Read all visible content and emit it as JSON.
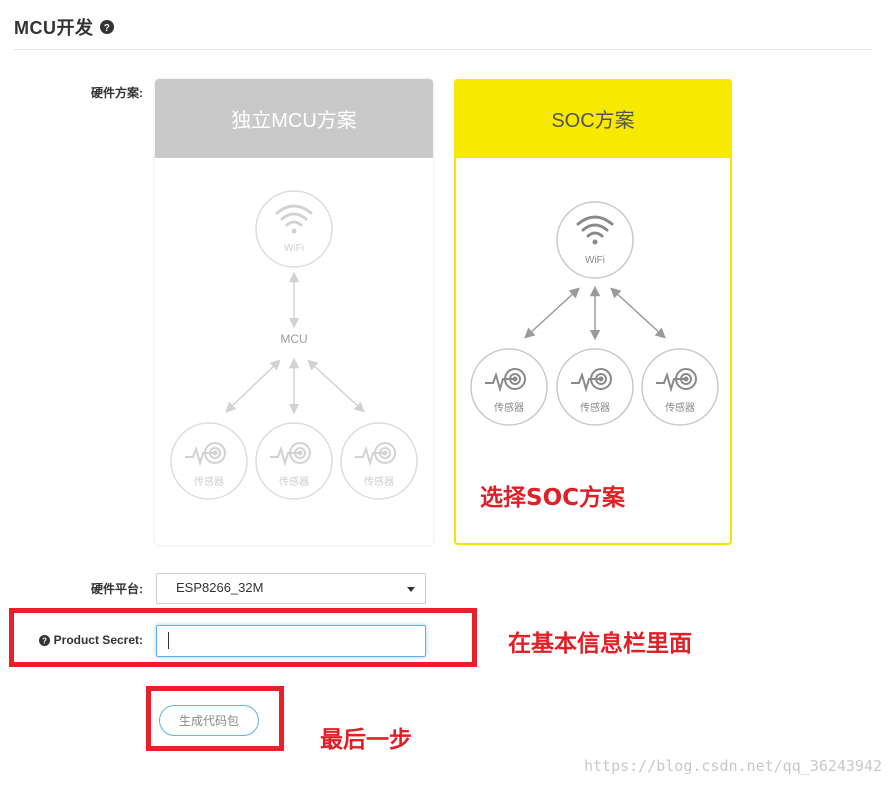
{
  "header": {
    "title": "MCU开发",
    "help_icon": "question-circle-icon"
  },
  "hardware_scheme": {
    "label": "硬件方案:",
    "options": [
      {
        "title": "独立MCU方案",
        "selected": false,
        "nodes": {
          "wifi": "WiFi",
          "mcu": "MCU",
          "sensors": [
            "传感器",
            "传感器",
            "传感器"
          ]
        }
      },
      {
        "title": "SOC方案",
        "selected": true,
        "nodes": {
          "wifi": "WiFi",
          "sensors": [
            "传感器",
            "传感器",
            "传感器"
          ]
        }
      }
    ]
  },
  "platform": {
    "label": "硬件平台:",
    "value": "ESP8266_32M"
  },
  "product_secret": {
    "label": "Product Secret:",
    "value": "",
    "placeholder": ""
  },
  "generate_button": {
    "label": "生成代码包"
  },
  "annotations": {
    "choose_soc": "选择SOC方案",
    "basic_info": "在基本信息栏里面",
    "last_step": "最后一步"
  },
  "watermark": "https://blog.csdn.net/qq_36243942",
  "colors": {
    "selected_accent": "#f7e900",
    "annotation_red": "#e8202a",
    "input_focus": "#66afe9"
  }
}
